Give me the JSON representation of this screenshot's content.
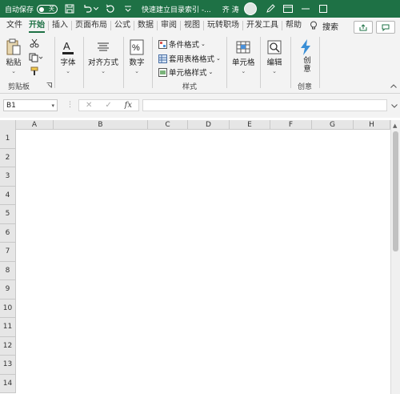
{
  "titlebar": {
    "autosave_label": "自动保存",
    "toggle_state": "关",
    "doc_title": "快速建立目录索引 -...",
    "user_name": "齐 涛"
  },
  "tabs": [
    "文件",
    "开始",
    "插入",
    "页面布局",
    "公式",
    "数据",
    "审阅",
    "视图",
    "玩转职场",
    "开发工具",
    "帮助"
  ],
  "active_tab": "开始",
  "search_label": "搜索",
  "ribbon": {
    "clipboard": {
      "paste": "粘贴",
      "group": "剪贴板"
    },
    "font": {
      "label": "字体"
    },
    "alignment": {
      "label": "对齐方式"
    },
    "number": {
      "label": "数字"
    },
    "styles": {
      "conditional": "条件格式",
      "table": "套用表格格式",
      "cell_styles": "单元格样式",
      "group": "样式"
    },
    "cells": {
      "label": "单元格"
    },
    "editing": {
      "label": "编辑"
    },
    "creative": {
      "label": "创意",
      "group": "创意"
    }
  },
  "formula_bar": {
    "name_box": "B1",
    "cancel": "✕",
    "enter": "✓",
    "fx": "fx",
    "value": ""
  },
  "columns": [
    "A",
    "B",
    "C",
    "D",
    "E",
    "F",
    "G",
    "H"
  ],
  "rows": [
    "1",
    "2",
    "3",
    "4",
    "5",
    "6",
    "7",
    "8",
    "9",
    "10",
    "11",
    "12",
    "13",
    "14"
  ],
  "colors": {
    "brand": "#1e7145",
    "ribbon_bg": "#f3f3f3",
    "header_bg": "#e6e6e6"
  }
}
